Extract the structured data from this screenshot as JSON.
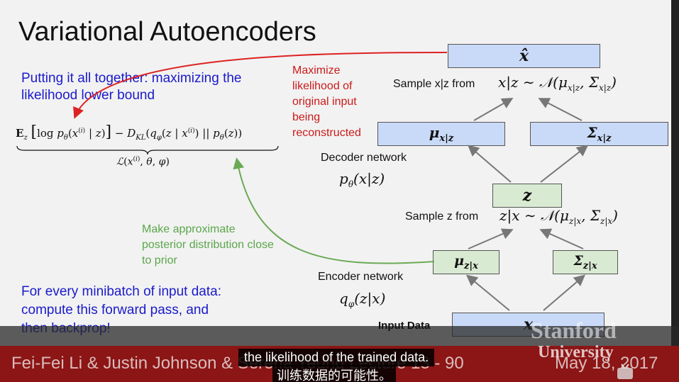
{
  "slide": {
    "title": "Variational Autoencoders",
    "summary": "Putting it all together: maximizing the likelihood lower bound",
    "maximize_note": "Maximize likelihood of original input being reconstructed",
    "approx_note": "Make approximate posterior distribution close to prior",
    "minibatch_note": "For every minibatch of input data: compute this forward pass, and then backprop!",
    "sample_x_label": "Sample x|z from",
    "sample_z_label": "Sample z from",
    "decoder_label": "Decoder network",
    "encoder_label": "Encoder network",
    "input_label": "Input Data",
    "xhat": "x̂",
    "mu_xz": "μx|z",
    "sigma_xz": "Σx|z",
    "z": "z",
    "mu_zx": "μz|x",
    "sigma_zx": "Σz|x",
    "x": "x",
    "decoder_formula": "pθ(x|z)",
    "encoder_formula": "qφ(z|x)",
    "sample_x_formula": "x|z ~ 𝒩(μx|z, Σx|z)",
    "sample_z_formula": "z|x ~ 𝒩(μz|x, Σz|x)",
    "bound_formula": "E_z[log pθ(x(i) | z)] − D_KL(qφ(z | x(i)) || pθ(z))",
    "bound_label": "ℒ(x(i), θ, φ)"
  },
  "footer": {
    "text": "Fei-Fei Li & Justin Johnson & Serena Yeung    Lecture 13 -   90",
    "date": "May 18, 2017",
    "logo_top": "Stanford",
    "logo_bottom": "University"
  },
  "subtitles": {
    "english": "the likelihood of the trained data.",
    "chinese": "训练数据的可能性。"
  },
  "colors": {
    "box_blue": "#c9daf8",
    "box_green": "#d9ead3",
    "footer": "#8c1515",
    "red_text": "#cc1a1a",
    "blue_text": "#1a1acc",
    "green_text": "#5aa64a"
  }
}
